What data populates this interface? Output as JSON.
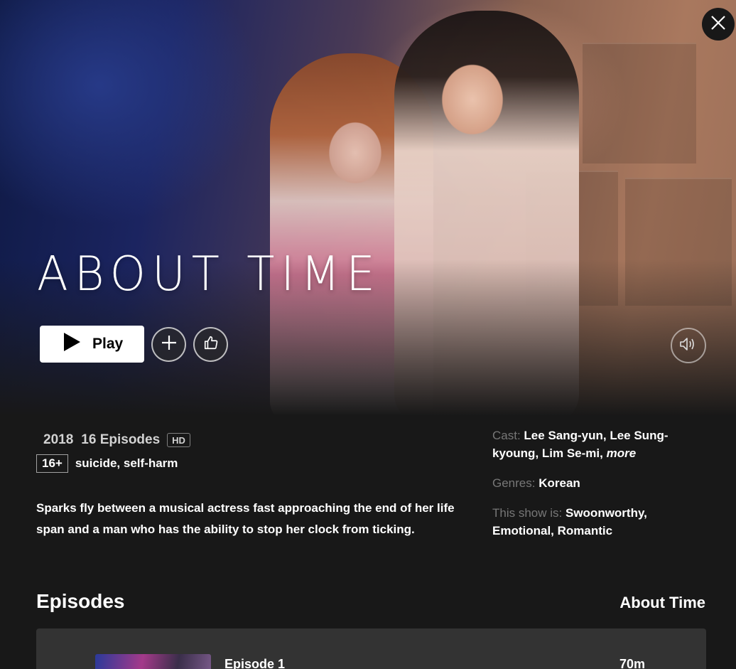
{
  "hero": {
    "title_logo": "ABOUT TIME",
    "play_label": "Play"
  },
  "details": {
    "year": "2018",
    "episodes_count": "16 Episodes",
    "quality_badge": "HD",
    "maturity_rating": "16+",
    "content_advisory": "suicide, self-harm",
    "synopsis": "Sparks fly between a musical actress fast approaching the end of her life span and a man who has the ability to stop her clock from ticking.",
    "cast_label": "Cast:",
    "cast_value": "Lee Sang-yun, Lee Sung-kyoung, Lim Se-mi,",
    "cast_more": "more",
    "genres_label": "Genres:",
    "genres_value": "Korean",
    "show_is_label": "This show is:",
    "show_is_value": "Swoonworthy, Emotional, Romantic"
  },
  "episodes": {
    "heading": "Episodes",
    "season_title": "About Time",
    "items": [
      {
        "title": "Episode 1",
        "duration": "70m"
      }
    ]
  },
  "icons": {
    "close": "close-icon",
    "play": "play-icon",
    "add": "plus-icon",
    "rate": "thumbs-up-icon",
    "audio": "volume-icon"
  }
}
